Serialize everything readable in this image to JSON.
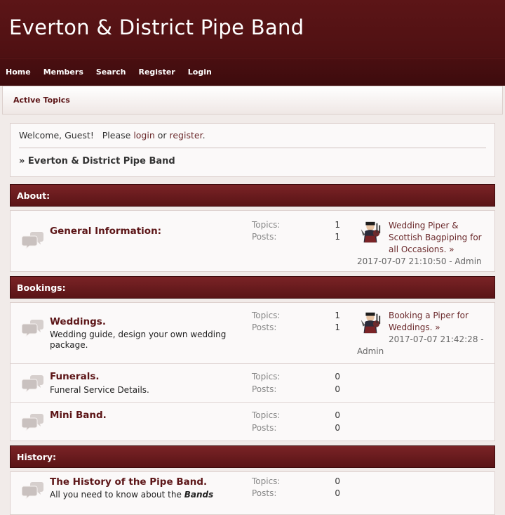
{
  "header": {
    "title": "Everton & District Pipe Band"
  },
  "nav": [
    "Home",
    "Members",
    "Search",
    "Register",
    "Login"
  ],
  "subnav": {
    "active_topics": "Active Topics"
  },
  "welcome": {
    "prefix": "Welcome, Guest!   Please ",
    "login": "login",
    "or": " or ",
    "register": "register",
    "suffix": ".",
    "breadcrumb": "» Everton & District Pipe Band"
  },
  "categories": [
    {
      "name": "About:",
      "boards": [
        {
          "title": "General Information:",
          "desc": "",
          "topics_label": "Topics:",
          "topics": "1",
          "posts_label": "Posts:",
          "posts": "1",
          "last_title": "Wedding Piper & Scottish Bagpiping for all Occasions. »",
          "last_meta": "2017-07-07 21:10:50 - Admin"
        }
      ]
    },
    {
      "name": "Bookings:",
      "boards": [
        {
          "title": "Weddings.",
          "desc": "Wedding guide, design your own wedding package.",
          "topics_label": "Topics:",
          "topics": "1",
          "posts_label": "Posts:",
          "posts": "1",
          "last_title": "Booking a Piper for Weddings. »",
          "last_meta": "2017-07-07 21:42:28 - Admin"
        },
        {
          "title": "Funerals.",
          "desc": "Funeral Service Details.",
          "topics_label": "Topics:",
          "topics": "0",
          "posts_label": "Posts:",
          "posts": "0"
        },
        {
          "title": "Mini Band.",
          "desc": "",
          "topics_label": "Topics:",
          "topics": "0",
          "posts_label": "Posts:",
          "posts": "0"
        }
      ]
    },
    {
      "name": "History:",
      "boards": [
        {
          "title": "The History of the Pipe Band.",
          "desc_prefix": "All you need to know about the ",
          "desc_em": "Bands",
          "topics_label": "Topics:",
          "topics": "0",
          "posts_label": "Posts:",
          "posts": "0"
        }
      ]
    }
  ],
  "icons": {
    "board": "speech-bubbles-icon",
    "avatar": "piper-avatar-icon"
  },
  "colors": {
    "brand": "#5c1517",
    "nav": "#3d0b0d",
    "link": "#6b2a2c"
  }
}
